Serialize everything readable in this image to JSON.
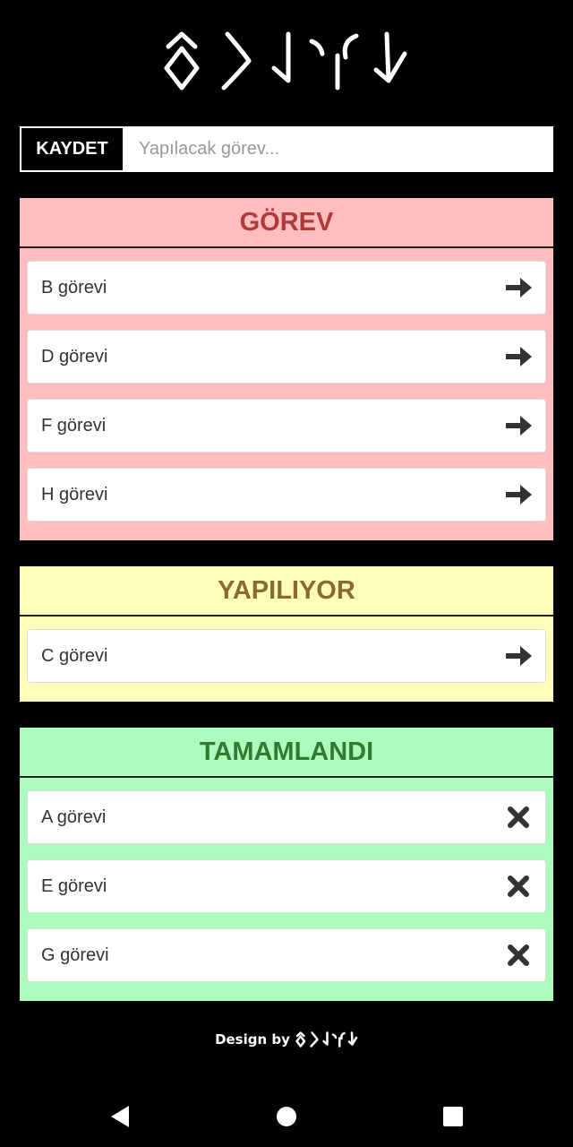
{
  "header": {
    "logo_text": "𐰇𐰯𐰆𐰺𐰚𐰢",
    "logo_name": "old-turkic-logo"
  },
  "input_bar": {
    "save_label": "KAYDET",
    "placeholder": "Yapılacak görev...",
    "value": ""
  },
  "columns": {
    "todo": {
      "title": "GÖREV",
      "color": "#ffbdbd",
      "title_color": "#b03a3a",
      "items": [
        {
          "label": "B görevi",
          "icon": "arrow-right-icon"
        },
        {
          "label": "D görevi",
          "icon": "arrow-right-icon"
        },
        {
          "label": "F görevi",
          "icon": "arrow-right-icon"
        },
        {
          "label": "H görevi",
          "icon": "arrow-right-icon"
        }
      ]
    },
    "doing": {
      "title": "YAPILIYOR",
      "color": "#ffffbb",
      "title_color": "#8a6a30",
      "items": [
        {
          "label": "C görevi",
          "icon": "arrow-right-icon"
        }
      ]
    },
    "done": {
      "title": "TAMAMLANDI",
      "color": "#adfcbd",
      "title_color": "#2e7d32",
      "items": [
        {
          "label": "A görevi",
          "icon": "close-x-icon"
        },
        {
          "label": "E görevi",
          "icon": "close-x-icon"
        },
        {
          "label": "G görevi",
          "icon": "close-x-icon"
        }
      ]
    }
  },
  "footer": {
    "prefix": "Design by"
  },
  "navbar": {
    "buttons": [
      "back-icon",
      "home-icon",
      "recents-icon"
    ]
  }
}
